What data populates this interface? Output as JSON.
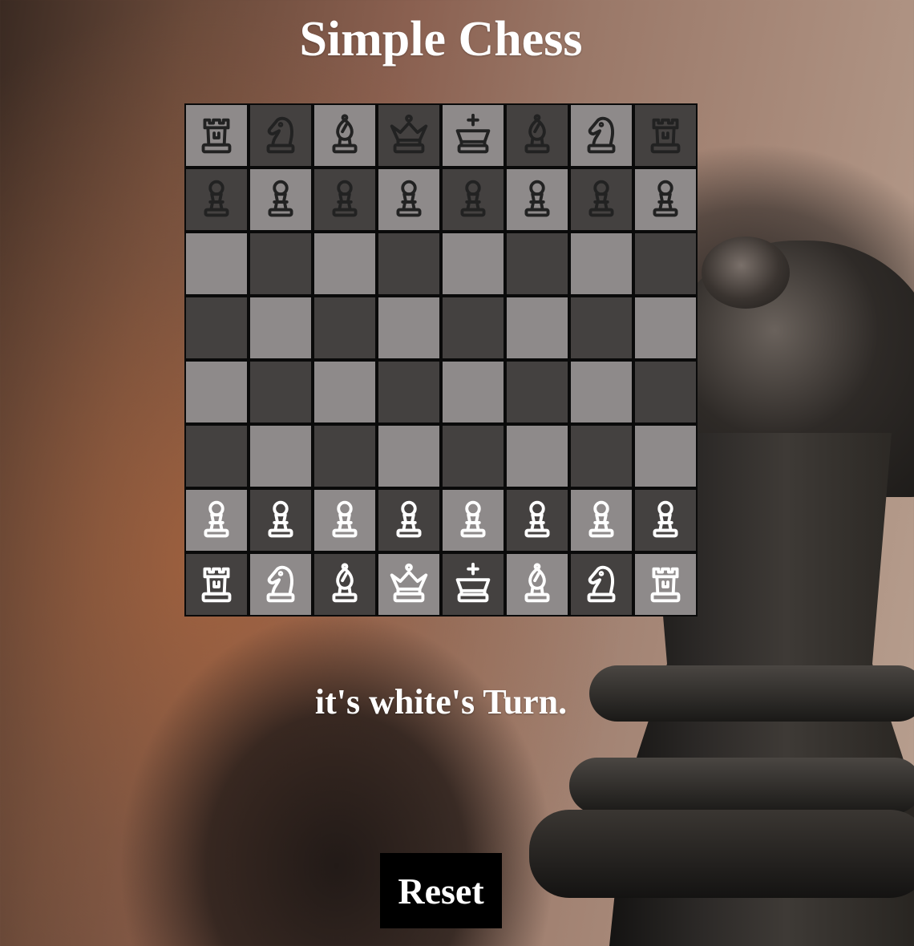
{
  "title": "Simple Chess",
  "status": "it's white's Turn.",
  "reset_label": "Reset",
  "colors": {
    "light_square": "#8e8a8a",
    "dark_square": "#444140",
    "black_piece": "#222222",
    "white_piece": "#ffffff"
  },
  "board": [
    [
      "br",
      "bn",
      "bb",
      "bq",
      "bk",
      "bb",
      "bn",
      "br"
    ],
    [
      "bp",
      "bp",
      "bp",
      "bp",
      "bp",
      "bp",
      "bp",
      "bp"
    ],
    [
      "",
      "",
      "",
      "",
      "",
      "",
      "",
      ""
    ],
    [
      "",
      "",
      "",
      "",
      "",
      "",
      "",
      ""
    ],
    [
      "",
      "",
      "",
      "",
      "",
      "",
      "",
      ""
    ],
    [
      "",
      "",
      "",
      "",
      "",
      "",
      "",
      ""
    ],
    [
      "wp",
      "wp",
      "wp",
      "wp",
      "wp",
      "wp",
      "wp",
      "wp"
    ],
    [
      "wr",
      "wn",
      "wb",
      "wq",
      "wk",
      "wb",
      "wn",
      "wr"
    ]
  ],
  "piece_names": {
    "p": "pawn",
    "r": "rook",
    "n": "knight",
    "b": "bishop",
    "q": "queen",
    "k": "king"
  },
  "side_names": {
    "w": "white",
    "b": "black"
  }
}
